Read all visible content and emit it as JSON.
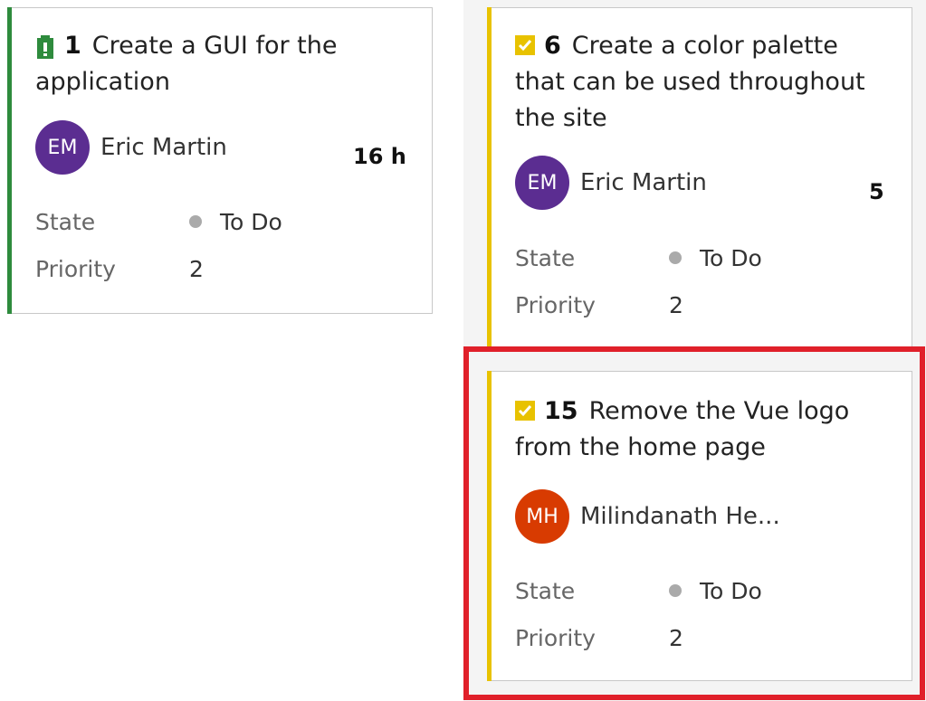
{
  "colors": {
    "user_story_accent": "#2e8b3d",
    "task_accent": "#e8c200",
    "avatar_em": "#5b2d91",
    "avatar_mh": "#d83b01",
    "state_dot": "#aaaaaa",
    "highlight": "#e0202a"
  },
  "cards": [
    {
      "type_icon": "user-story-icon",
      "id": "1",
      "title": "Create a GUI for the application",
      "assignee": {
        "initials": "EM",
        "name": "Eric Martin"
      },
      "effort": "16 h",
      "state_label": "State",
      "state_value": "To Do",
      "priority_label": "Priority",
      "priority_value": "2"
    },
    {
      "type_icon": "task-check-icon",
      "id": "6",
      "title": "Create a color palette that can be used throughout the site",
      "assignee": {
        "initials": "EM",
        "name": "Eric Martin"
      },
      "effort": "5",
      "state_label": "State",
      "state_value": "To Do",
      "priority_label": "Priority",
      "priority_value": "2"
    },
    {
      "type_icon": "task-check-icon",
      "id": "15",
      "title": "Remove the Vue logo from the home page",
      "assignee": {
        "initials": "MH",
        "name": "Milindanath He..."
      },
      "effort": "",
      "state_label": "State",
      "state_value": "To Do",
      "priority_label": "Priority",
      "priority_value": "2"
    }
  ]
}
